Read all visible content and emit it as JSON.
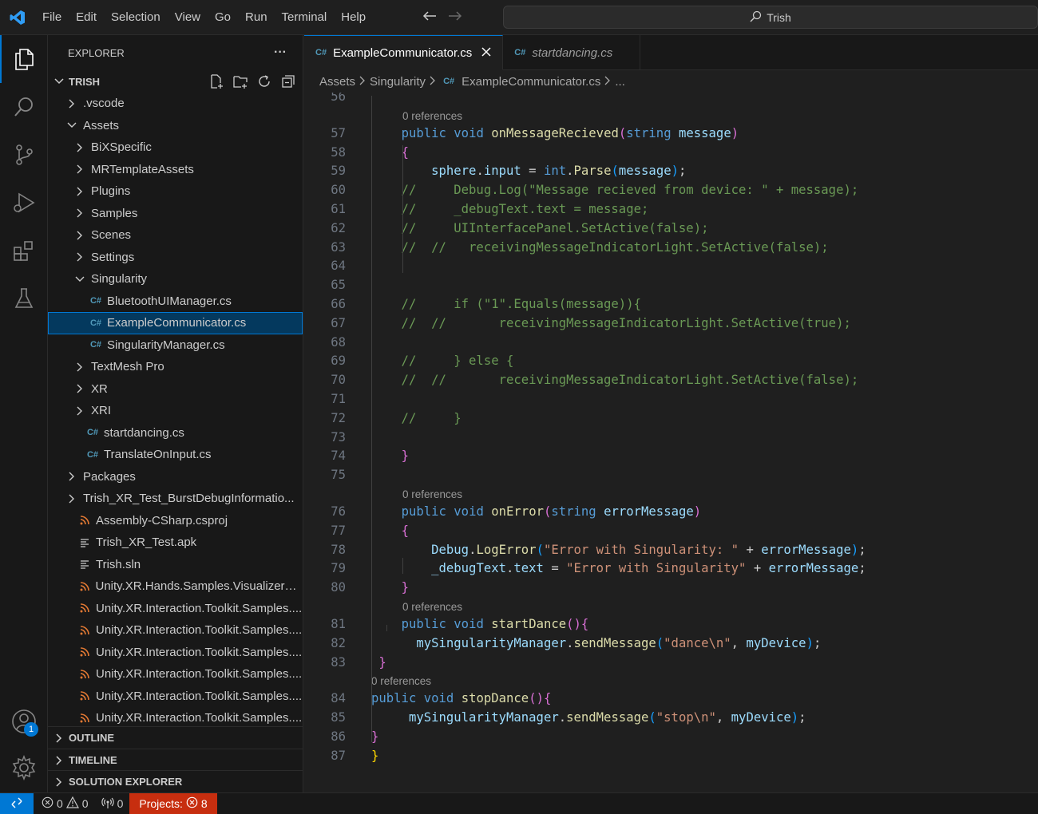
{
  "menu": [
    "File",
    "Edit",
    "Selection",
    "View",
    "Go",
    "Run",
    "Terminal",
    "Help"
  ],
  "search": {
    "text": "Trish"
  },
  "activity": {
    "accounts_badge": "1"
  },
  "explorer": {
    "title": "EXPLORER",
    "more": "···",
    "root": "TRISH",
    "tree": [
      {
        "label": ".vscode",
        "indent": 1,
        "type": "folder",
        "open": false
      },
      {
        "label": "Assets",
        "indent": 1,
        "type": "folder",
        "open": true
      },
      {
        "label": "BiXSpecific",
        "indent": 2,
        "type": "folder",
        "open": false
      },
      {
        "label": "MRTemplateAssets",
        "indent": 2,
        "type": "folder",
        "open": false
      },
      {
        "label": "Plugins",
        "indent": 2,
        "type": "folder",
        "open": false
      },
      {
        "label": "Samples",
        "indent": 2,
        "type": "folder",
        "open": false
      },
      {
        "label": "Scenes",
        "indent": 2,
        "type": "folder",
        "open": false
      },
      {
        "label": "Settings",
        "indent": 2,
        "type": "folder",
        "open": false
      },
      {
        "label": "Singularity",
        "indent": 2,
        "type": "folder",
        "open": true
      },
      {
        "label": "BluetoothUIManager.cs",
        "indent": 3,
        "type": "cs"
      },
      {
        "label": "ExampleCommunicator.cs",
        "indent": 3,
        "type": "cs",
        "selected": true
      },
      {
        "label": "SingularityManager.cs",
        "indent": 3,
        "type": "cs"
      },
      {
        "label": "TextMesh Pro",
        "indent": 2,
        "type": "folder",
        "open": false
      },
      {
        "label": "XR",
        "indent": 2,
        "type": "folder",
        "open": false
      },
      {
        "label": "XRI",
        "indent": 2,
        "type": "folder",
        "open": false
      },
      {
        "label": "startdancing.cs",
        "indent": 2,
        "type": "cs"
      },
      {
        "label": "TranslateOnInput.cs",
        "indent": 2,
        "type": "cs"
      },
      {
        "label": "Packages",
        "indent": 1,
        "type": "folder",
        "open": false
      },
      {
        "label": "Trish_XR_Test_BurstDebugInformatio...",
        "indent": 1,
        "type": "folder",
        "open": false
      },
      {
        "label": "Assembly-CSharp.csproj",
        "indent": 1,
        "type": "rss"
      },
      {
        "label": "Trish_XR_Test.apk",
        "indent": 1,
        "type": "txt"
      },
      {
        "label": "Trish.sln",
        "indent": 1,
        "type": "txt"
      },
      {
        "label": "Unity.XR.Hands.Samples.VisualizerSa...",
        "indent": 1,
        "type": "rss"
      },
      {
        "label": "Unity.XR.Interaction.Toolkit.Samples....",
        "indent": 1,
        "type": "rss"
      },
      {
        "label": "Unity.XR.Interaction.Toolkit.Samples....",
        "indent": 1,
        "type": "rss"
      },
      {
        "label": "Unity.XR.Interaction.Toolkit.Samples....",
        "indent": 1,
        "type": "rss"
      },
      {
        "label": "Unity.XR.Interaction.Toolkit.Samples....",
        "indent": 1,
        "type": "rss"
      },
      {
        "label": "Unity.XR.Interaction.Toolkit.Samples....",
        "indent": 1,
        "type": "rss"
      },
      {
        "label": "Unity.XR.Interaction.Toolkit.Samples....",
        "indent": 1,
        "type": "rss"
      }
    ],
    "sections": [
      "OUTLINE",
      "TIMELINE",
      "SOLUTION EXPLORER"
    ]
  },
  "tabs": [
    {
      "label": "ExampleCommunicator.cs",
      "active": true
    },
    {
      "label": "startdancing.cs",
      "active": false
    }
  ],
  "breadcrumb": [
    "Assets",
    "Singularity",
    "ExampleCommunicator.cs",
    "..."
  ],
  "editor": {
    "lines": [
      {
        "n": "56",
        "t": []
      },
      {
        "lens": "0 references"
      },
      {
        "n": "57",
        "t": [
          [
            "    ",
            "plain"
          ],
          [
            "public",
            "kw"
          ],
          [
            " ",
            "plain"
          ],
          [
            "void",
            "kw"
          ],
          [
            " ",
            "plain"
          ],
          [
            "onMessageRecieved",
            "fn"
          ],
          [
            "(",
            "p2"
          ],
          [
            "string",
            "kw"
          ],
          [
            " ",
            "plain"
          ],
          [
            "message",
            "var"
          ],
          [
            ")",
            "p2"
          ]
        ]
      },
      {
        "n": "58",
        "t": [
          [
            "    ",
            "plain"
          ],
          [
            "{",
            "p2"
          ]
        ]
      },
      {
        "n": "59",
        "t": [
          [
            "        ",
            "plain"
          ],
          [
            "sphere",
            "var"
          ],
          [
            ".",
            "plain"
          ],
          [
            "input",
            "var"
          ],
          [
            " = ",
            "plain"
          ],
          [
            "int",
            "kw"
          ],
          [
            ".",
            "plain"
          ],
          [
            "Parse",
            "fn"
          ],
          [
            "(",
            "p3"
          ],
          [
            "message",
            "var"
          ],
          [
            ")",
            "p3"
          ],
          [
            ";",
            "plain"
          ]
        ]
      },
      {
        "n": "60",
        "t": [
          [
            "    //     Debug.Log(\"Message recieved from device: \" + message);",
            "cm"
          ]
        ]
      },
      {
        "n": "61",
        "t": [
          [
            "    //     _debugText.text = message;",
            "cm"
          ]
        ]
      },
      {
        "n": "62",
        "t": [
          [
            "    //     UIInterfacePanel.SetActive(false);",
            "cm"
          ]
        ]
      },
      {
        "n": "63",
        "t": [
          [
            "    //  //   receivingMessageIndicatorLight.SetActive(false);",
            "cm"
          ]
        ]
      },
      {
        "n": "64",
        "t": []
      },
      {
        "n": "65",
        "t": []
      },
      {
        "n": "66",
        "t": [
          [
            "    //     if (\"1\".Equals(message)){",
            "cm"
          ]
        ]
      },
      {
        "n": "67",
        "t": [
          [
            "    //  //       receivingMessageIndicatorLight.SetActive(true);",
            "cm"
          ]
        ]
      },
      {
        "n": "68",
        "t": []
      },
      {
        "n": "69",
        "t": [
          [
            "    //     } else {",
            "cm"
          ]
        ]
      },
      {
        "n": "70",
        "t": [
          [
            "    //  //       receivingMessageIndicatorLight.SetActive(false);",
            "cm"
          ]
        ]
      },
      {
        "n": "71",
        "t": []
      },
      {
        "n": "72",
        "t": [
          [
            "    //     }",
            "cm"
          ]
        ]
      },
      {
        "n": "73",
        "t": []
      },
      {
        "n": "74",
        "t": [
          [
            "    ",
            "plain"
          ],
          [
            "}",
            "p2"
          ]
        ]
      },
      {
        "n": "75",
        "t": []
      },
      {
        "lens": "0 references"
      },
      {
        "n": "76",
        "t": [
          [
            "    ",
            "plain"
          ],
          [
            "public",
            "kw"
          ],
          [
            " ",
            "plain"
          ],
          [
            "void",
            "kw"
          ],
          [
            " ",
            "plain"
          ],
          [
            "onError",
            "fn"
          ],
          [
            "(",
            "p2"
          ],
          [
            "string",
            "kw"
          ],
          [
            " ",
            "plain"
          ],
          [
            "errorMessage",
            "var"
          ],
          [
            ")",
            "p2"
          ]
        ]
      },
      {
        "n": "77",
        "t": [
          [
            "    ",
            "plain"
          ],
          [
            "{",
            "p2"
          ]
        ]
      },
      {
        "n": "78",
        "t": [
          [
            "        ",
            "plain"
          ],
          [
            "Debug",
            "var"
          ],
          [
            ".",
            "plain"
          ],
          [
            "LogError",
            "fn"
          ],
          [
            "(",
            "p3"
          ],
          [
            "\"Error with Singularity: \"",
            "str"
          ],
          [
            " + ",
            "plain"
          ],
          [
            "errorMessage",
            "var"
          ],
          [
            ")",
            "p3"
          ],
          [
            ";",
            "plain"
          ]
        ]
      },
      {
        "n": "79",
        "t": [
          [
            "        ",
            "plain"
          ],
          [
            "_debugText",
            "var"
          ],
          [
            ".",
            "plain"
          ],
          [
            "text",
            "var"
          ],
          [
            " = ",
            "plain"
          ],
          [
            "\"Error with Singularity\"",
            "str"
          ],
          [
            " + ",
            "plain"
          ],
          [
            "errorMessage",
            "var"
          ],
          [
            ";",
            "plain"
          ]
        ]
      },
      {
        "n": "80",
        "t": [
          [
            "    ",
            "plain"
          ],
          [
            "}",
            "p2"
          ]
        ]
      },
      {
        "lens": "0 references"
      },
      {
        "n": "81",
        "t": [
          [
            "    ",
            "plain"
          ],
          [
            "public",
            "kw"
          ],
          [
            " ",
            "plain"
          ],
          [
            "void",
            "kw"
          ],
          [
            " ",
            "plain"
          ],
          [
            "startDance",
            "fn"
          ],
          [
            "()",
            "p2"
          ],
          [
            "{",
            "p2"
          ]
        ]
      },
      {
        "n": "82",
        "t": [
          [
            "      ",
            "plain"
          ],
          [
            "mySingularityManager",
            "var"
          ],
          [
            ".",
            "plain"
          ],
          [
            "sendMessage",
            "fn"
          ],
          [
            "(",
            "p3"
          ],
          [
            "\"dance\\n\"",
            "str"
          ],
          [
            ", ",
            "plain"
          ],
          [
            "myDevice",
            "var"
          ],
          [
            ")",
            "p3"
          ],
          [
            ";",
            "plain"
          ]
        ]
      },
      {
        "n": "83",
        "t": [
          [
            " ",
            "plain"
          ],
          [
            "}",
            "p2"
          ]
        ]
      },
      {
        "lens": "0 references",
        "shallow": true
      },
      {
        "n": "84",
        "t": [
          [
            "public",
            "kw"
          ],
          [
            " ",
            "plain"
          ],
          [
            "void",
            "kw"
          ],
          [
            " ",
            "plain"
          ],
          [
            "stopDance",
            "fn"
          ],
          [
            "()",
            "p2"
          ],
          [
            "{",
            "p2"
          ]
        ]
      },
      {
        "n": "85",
        "t": [
          [
            "     ",
            "plain"
          ],
          [
            "mySingularityManager",
            "var"
          ],
          [
            ".",
            "plain"
          ],
          [
            "sendMessage",
            "fn"
          ],
          [
            "(",
            "p3"
          ],
          [
            "\"stop\\n\"",
            "str"
          ],
          [
            ", ",
            "plain"
          ],
          [
            "myDevice",
            "var"
          ],
          [
            ")",
            "p3"
          ],
          [
            ";",
            "plain"
          ]
        ]
      },
      {
        "n": "86",
        "t": [
          [
            "}",
            "p2"
          ]
        ]
      },
      {
        "n": "87",
        "t": [
          [
            "}",
            "p1"
          ]
        ]
      }
    ]
  },
  "status": {
    "errors": "0",
    "warnings": "0",
    "ports": "0",
    "projects_label": "Projects:",
    "projects_errors": "8"
  }
}
